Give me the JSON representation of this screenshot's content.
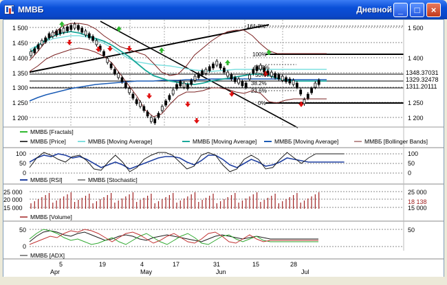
{
  "window": {
    "title": "ММВБ",
    "period": "Дневной",
    "minimize_glyph": "_",
    "maximize_glyph": "□",
    "close_glyph": "×"
  },
  "colors": {
    "up_arrow": "#2eb82e",
    "down_arrow": "#e01010",
    "price": "#000000",
    "ma_fast": "#7fe0e0",
    "ma_mid": "#1aa89a",
    "ma_slow": "#1a5bb5",
    "bollinger": "#7a2020",
    "rsi": "#1f3fa0",
    "stochastic": "#1a1a1a",
    "volume": "#a02020",
    "adx": "#1a1a1a"
  },
  "price_panel": {
    "y_ticks": [
      "1 500",
      "1 450",
      "1 400",
      "1 350",
      "1 300",
      "1 250",
      "1 200"
    ],
    "price_labels": [
      "1348.37031",
      "1329.32478",
      "1311.20111"
    ],
    "fib_labels": [
      "161.8%",
      "100%",
      "61.8%",
      "50%",
      "38.2%",
      "23.6%",
      "0%"
    ],
    "legend": [
      {
        "icon": "fractals",
        "label": "ММВБ [Fractals]"
      },
      {
        "icon": "price",
        "label": "ММВБ [Price]"
      },
      {
        "icon": "ma-fast",
        "label": "ММВБ [Moving Average]"
      },
      {
        "icon": "ma-mid",
        "label": "ММВБ [Moving Average]"
      },
      {
        "icon": "ma-slow",
        "label": "ММВБ [Moving Average]"
      },
      {
        "icon": "bollinger",
        "label": "ММВБ [Bollinger Bands]"
      }
    ]
  },
  "rsi_panel": {
    "y_ticks": [
      "100",
      "50",
      "0"
    ],
    "legend": [
      {
        "icon": "rsi",
        "label": "ММВБ [RSI]"
      },
      {
        "icon": "stochastic",
        "label": "ММВБ [Stochastic]"
      }
    ]
  },
  "volume_panel": {
    "y_ticks": [
      "25 000",
      "20 000",
      "15 000"
    ],
    "left_ticks": [
      "25 000",
      "20 000",
      "15 000"
    ],
    "current_value": "18 138",
    "legend": [
      {
        "icon": "volume",
        "label": "ММВБ [Volume]"
      }
    ]
  },
  "adx_panel": {
    "y_ticks": [
      "50"
    ],
    "left_ticks": [
      "50",
      "0"
    ],
    "legend": [
      {
        "icon": "adx",
        "label": "ММВБ [ADX]"
      }
    ]
  },
  "x_axis": {
    "days": [
      "5",
      "19",
      "4",
      "17",
      "31",
      "15",
      "28"
    ],
    "months": [
      "Apr",
      "May",
      "Jun",
      "Jul"
    ]
  }
}
